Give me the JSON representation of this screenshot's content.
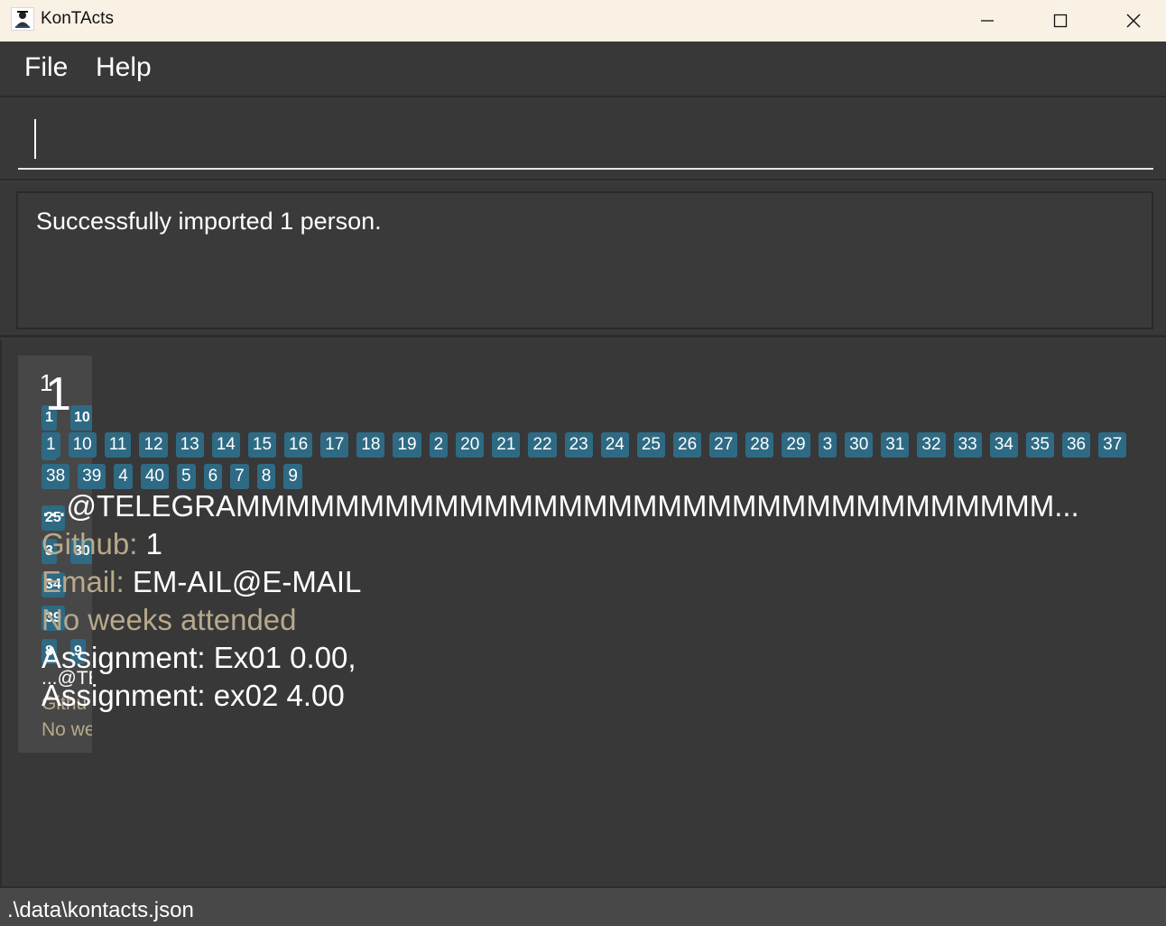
{
  "window": {
    "title": "KonTActs",
    "icon": "app-logo-icon",
    "controls": [
      "minimize-icon",
      "maximize-icon",
      "close-icon"
    ]
  },
  "menu": {
    "file": "File",
    "help": "Help"
  },
  "command": {
    "value": ""
  },
  "result": {
    "message": "Successfully imported 1 person."
  },
  "list": {
    "background_card": {
      "index": "1.",
      "name": "1",
      "tags": [
        "1",
        "10",
        "1",
        "25",
        "3",
        "30",
        "34",
        "39",
        "8",
        "9"
      ],
      "telegram": "...@TE",
      "github_label": "Githu",
      "attendance": "No we"
    },
    "card": {
      "index": "1.",
      "name": "1",
      "tags": [
        "1",
        "10",
        "11",
        "12",
        "13",
        "14",
        "15",
        "16",
        "17",
        "18",
        "19",
        "2",
        "20",
        "21",
        "22",
        "23",
        "24",
        "25",
        "26",
        "27",
        "28",
        "29",
        "3",
        "30",
        "31",
        "32",
        "33",
        "34",
        "35",
        "36",
        "37",
        "38",
        "39",
        "4",
        "40",
        "5",
        "6",
        "7",
        "8",
        "9"
      ],
      "telegram": "...@TELEGRAMMMMMMMMMMMMMMMMMMMMMMMMMMMMMMMMM...",
      "github_label": "Github:",
      "github_value": "1",
      "email_label": "Email:",
      "email_value": "EM-AIL@E-MAIL",
      "attendance": "No weeks attended",
      "assignments": [
        "Assignment: Ex01 0.00,",
        "Assignment: ex02 4.00"
      ]
    }
  },
  "status": {
    "path": ".\\data\\kontacts.json"
  },
  "colors": {
    "background": "#383838",
    "titlebar": "#f8f1e4",
    "tag": "#2e6a84",
    "label": "#b8a98b",
    "text": "#ffffff"
  }
}
